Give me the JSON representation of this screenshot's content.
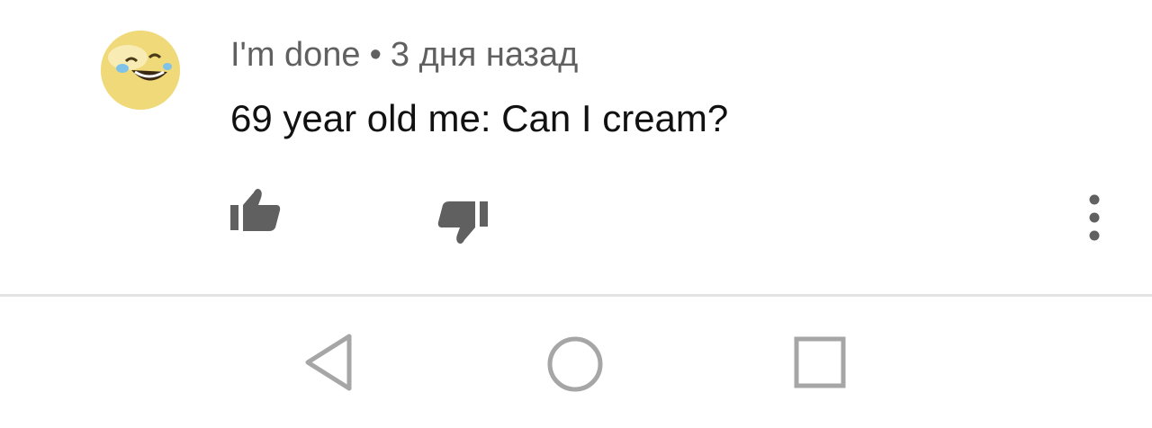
{
  "comment": {
    "author": "I'm done",
    "separator": "•",
    "time": "3 дня назад",
    "text": "69 year old me: Can I cream?",
    "avatar_icon": "laughing-face-icon",
    "actions": {
      "like_icon": "thumbs-up-icon",
      "dislike_icon": "thumbs-down-icon",
      "more_icon": "more-vertical-icon"
    }
  },
  "navbar": {
    "back_icon": "back-triangle-icon",
    "home_icon": "home-circle-icon",
    "recents_icon": "recents-square-icon"
  },
  "colors": {
    "icon_gray": "#606060",
    "text_primary": "#111111",
    "nav_gray": "#a6a6a6",
    "divider": "#e3e3e3",
    "avatar_yellow": "#f3e08a"
  }
}
